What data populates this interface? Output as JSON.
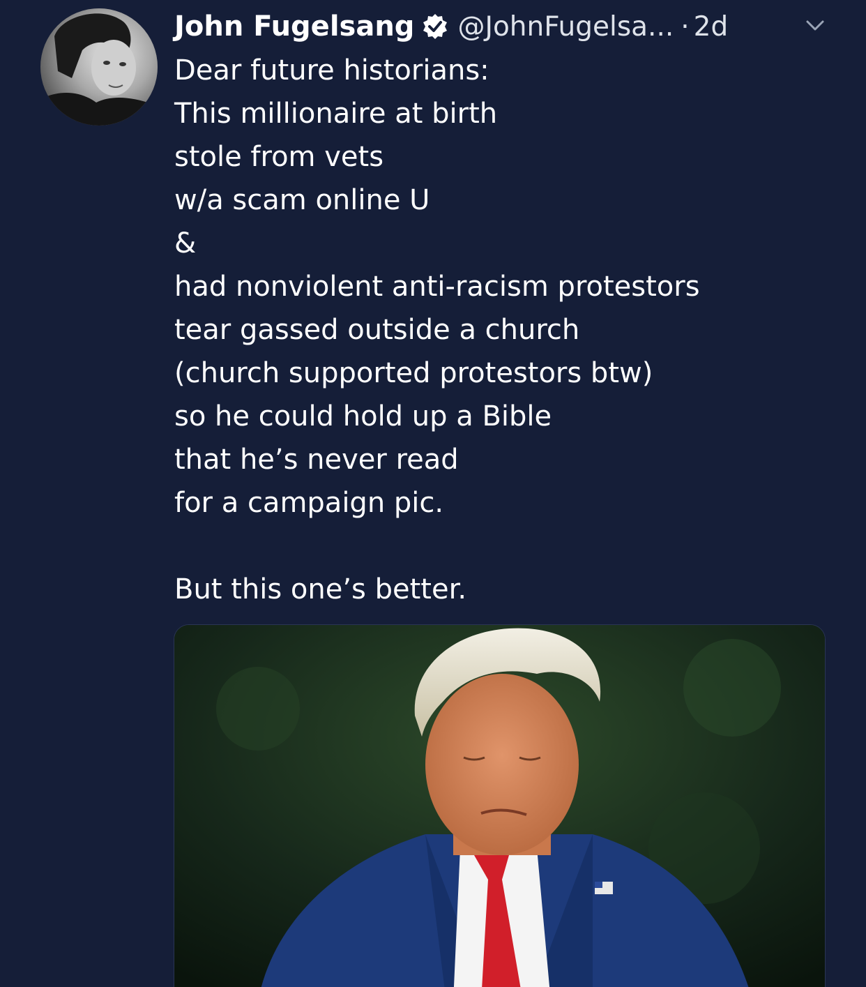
{
  "tweet": {
    "display_name": "John Fugelsang",
    "verified_icon": "verified-badge-icon",
    "handle": "@JohnFugelsa...",
    "separator": "·",
    "time": "2d",
    "caret_icon": "chevron-down-icon",
    "lines": [
      "Dear future historians:",
      "This millionaire at birth",
      "stole from vets",
      "w/a scam online U",
      "&",
      "had nonviolent anti-racism protestors",
      "tear gassed outside a church",
      "(church supported protestors btw)",
      "so he could hold up a Bible",
      "that he’s never read",
      "for a campaign pic."
    ],
    "closing_line": "But this one’s better."
  },
  "colors": {
    "background": "#151e38",
    "text": "#ffffff",
    "secondary_text": "#dfe3ea"
  }
}
